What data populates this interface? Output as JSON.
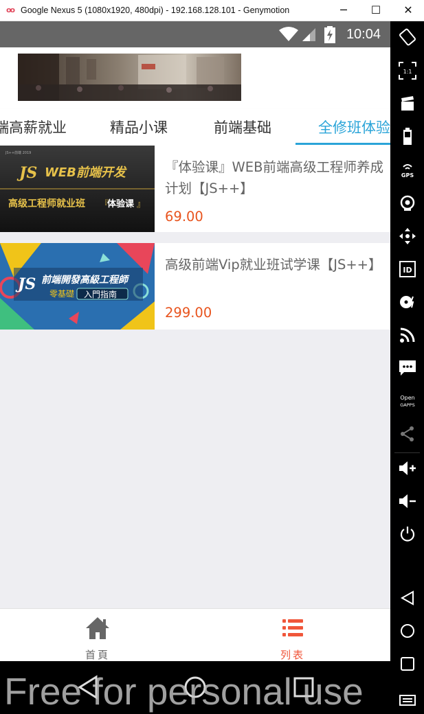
{
  "window": {
    "title": "Google Nexus 5 (1080x1920, 480dpi) - 192.168.128.101 - Genymotion",
    "logo": "oo"
  },
  "status_bar": {
    "time": "10:04"
  },
  "tabs": [
    {
      "label": "端高薪就业",
      "active": false
    },
    {
      "label": "精品小课",
      "active": false
    },
    {
      "label": "前端基础",
      "active": false
    },
    {
      "label": "全修班体验",
      "active": true
    }
  ],
  "courses": [
    {
      "title": "『体验课』WEB前端高级工程师养成计划【JS++】",
      "price": "69.00",
      "thumb": {
        "line1": "WEB前端开发",
        "line2": "高级工程师就业班",
        "line3": "体验课",
        "logo": "JS",
        "small": "JS++前端 2019"
      }
    },
    {
      "title": "高级前端Vip就业班试学课【JS++】",
      "price": "299.00",
      "thumb": {
        "line1": "前端開發高級工程師",
        "line2": "零基礎",
        "line3": "入門指南",
        "logo": "JS"
      }
    }
  ],
  "bottom_nav": [
    {
      "label": "首頁",
      "active": false,
      "icon": "home-icon"
    },
    {
      "label": "列表",
      "active": true,
      "icon": "list-icon"
    }
  ],
  "watermark": "Free for personal use",
  "toolbar": {
    "id_label": "ID",
    "gps_label": "GPS",
    "open_gapps": [
      "Open",
      "GAPPS"
    ],
    "pixel_ratio": "1:1"
  },
  "colors": {
    "accent_blue": "#2aa4d8",
    "price_orange": "#e8541e",
    "active_nav": "#f0563a",
    "inactive_nav": "#666666"
  }
}
